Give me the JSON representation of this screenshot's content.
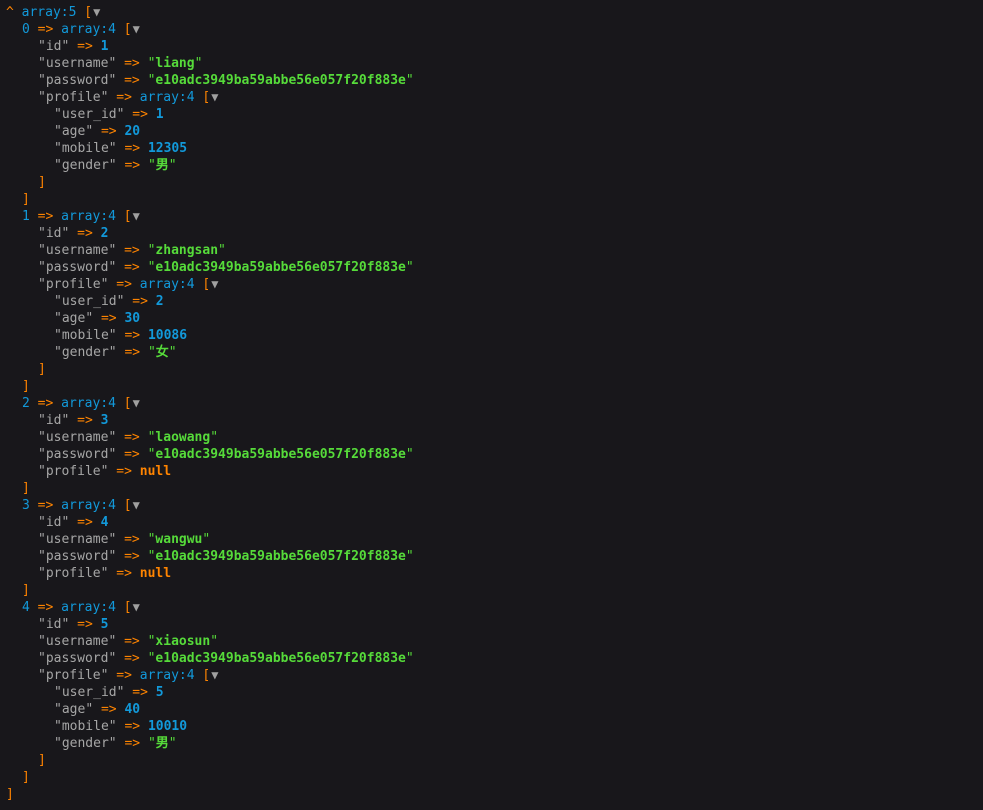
{
  "colors": {
    "background": "#18171b",
    "key": "#a6a6a6",
    "arrow": "#ff8400",
    "meta": "#1299da",
    "number": "#1299da",
    "string": "#56db3a",
    "null": "#ff8400",
    "toggle": "#a0a0a0"
  },
  "icons": {
    "collapse_caret": "^",
    "toggle": "▼"
  },
  "dump": {
    "type_label": "array:5",
    "items": [
      {
        "index": "0",
        "type_label": "array:4",
        "id": "1",
        "username": "liang",
        "password": "e10adc3949ba59abbe56e057f20f883e",
        "profile": {
          "type_label": "array:4",
          "user_id": "1",
          "age": "20",
          "mobile": "12305",
          "gender": "男"
        }
      },
      {
        "index": "1",
        "type_label": "array:4",
        "id": "2",
        "username": "zhangsan",
        "password": "e10adc3949ba59abbe56e057f20f883e",
        "profile": {
          "type_label": "array:4",
          "user_id": "2",
          "age": "30",
          "mobile": "10086",
          "gender": "女"
        }
      },
      {
        "index": "2",
        "type_label": "array:4",
        "id": "3",
        "username": "laowang",
        "password": "e10adc3949ba59abbe56e057f20f883e",
        "profile": null
      },
      {
        "index": "3",
        "type_label": "array:4",
        "id": "4",
        "username": "wangwu",
        "password": "e10adc3949ba59abbe56e057f20f883e",
        "profile": null
      },
      {
        "index": "4",
        "type_label": "array:4",
        "id": "5",
        "username": "xiaosun",
        "password": "e10adc3949ba59abbe56e057f20f883e",
        "profile": {
          "type_label": "array:4",
          "user_id": "5",
          "age": "40",
          "mobile": "10010",
          "gender": "男"
        }
      }
    ]
  },
  "tokens": {
    "arrow": "=>",
    "open_bracket": "[",
    "close_bracket": "]",
    "null_value": "null",
    "key_id": "id",
    "key_username": "username",
    "key_password": "password",
    "key_profile": "profile",
    "key_user_id": "user_id",
    "key_age": "age",
    "key_mobile": "mobile",
    "key_gender": "gender"
  }
}
